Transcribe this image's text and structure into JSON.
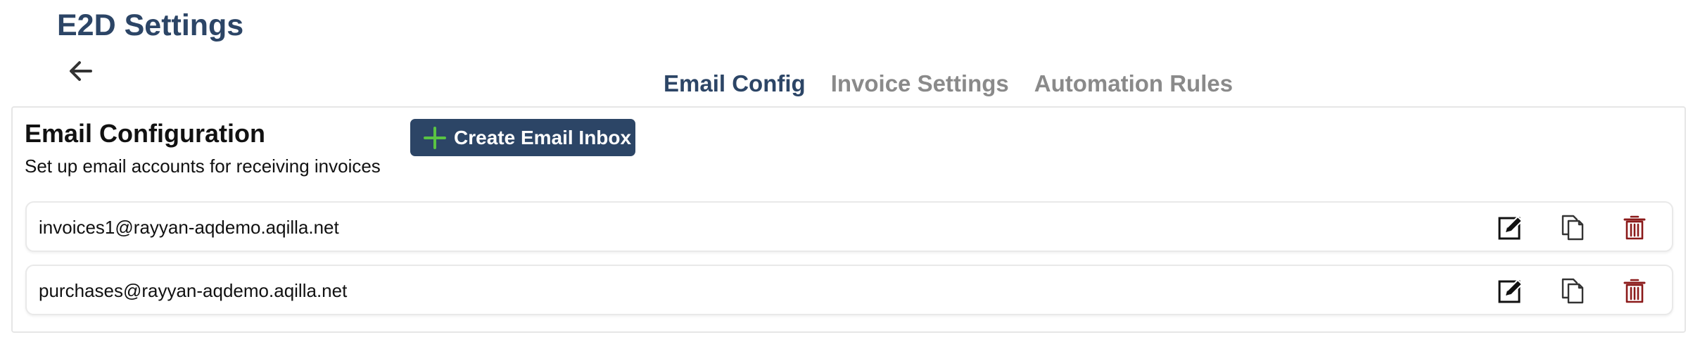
{
  "header": {
    "title": "E2D Settings"
  },
  "tabs": [
    {
      "label": "Email Config",
      "active": true
    },
    {
      "label": "Invoice Settings",
      "active": false
    },
    {
      "label": "Automation Rules",
      "active": false
    }
  ],
  "email_config": {
    "title": "Email Configuration",
    "subtitle": "Set up email accounts for receiving invoices",
    "create_button_label": "Create Email Inbox",
    "inboxes": [
      {
        "email": "invoices1@rayyan-aqdemo.aqilla.net"
      },
      {
        "email": "purchases@rayyan-aqdemo.aqilla.net"
      }
    ]
  },
  "icons": {
    "back": "arrow-left-icon",
    "create": "plus-icon",
    "edit": "edit-icon",
    "copy": "copy-icon",
    "delete": "trash-icon"
  },
  "colors": {
    "brand": "#2c4566",
    "tab_inactive": "#8a8a8a",
    "plus": "#5ac443",
    "delete": "#8b1a1a"
  }
}
